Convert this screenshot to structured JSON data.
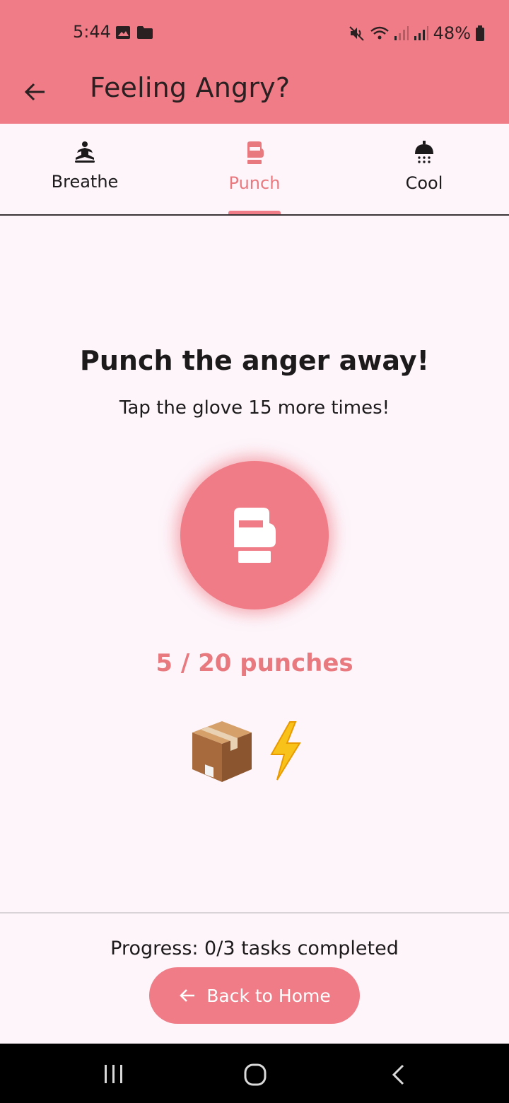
{
  "status_bar": {
    "time": "5:44",
    "battery": "48%"
  },
  "app_bar": {
    "title": "Feeling Angry?"
  },
  "tabs": [
    {
      "label": "Breathe",
      "icon": "meditation-icon",
      "active": false
    },
    {
      "label": "Punch",
      "icon": "boxing-glove-icon",
      "active": true
    },
    {
      "label": "Cool",
      "icon": "shower-icon",
      "active": false
    }
  ],
  "punch": {
    "title": "Punch the anger away!",
    "instruction": "Tap the glove 15 more times!",
    "counter": "5 / 20 punches",
    "count": 5,
    "goal": 20,
    "rewards": [
      "📦",
      "⚡"
    ]
  },
  "footer": {
    "progress_text": "Progress: 0/3 tasks completed",
    "home_button_label": "Back to Home"
  },
  "colors": {
    "accent": "#ef7c86",
    "accent_text": "#e8797f",
    "background": "#fdf5fa",
    "text": "#1d1a1c"
  }
}
